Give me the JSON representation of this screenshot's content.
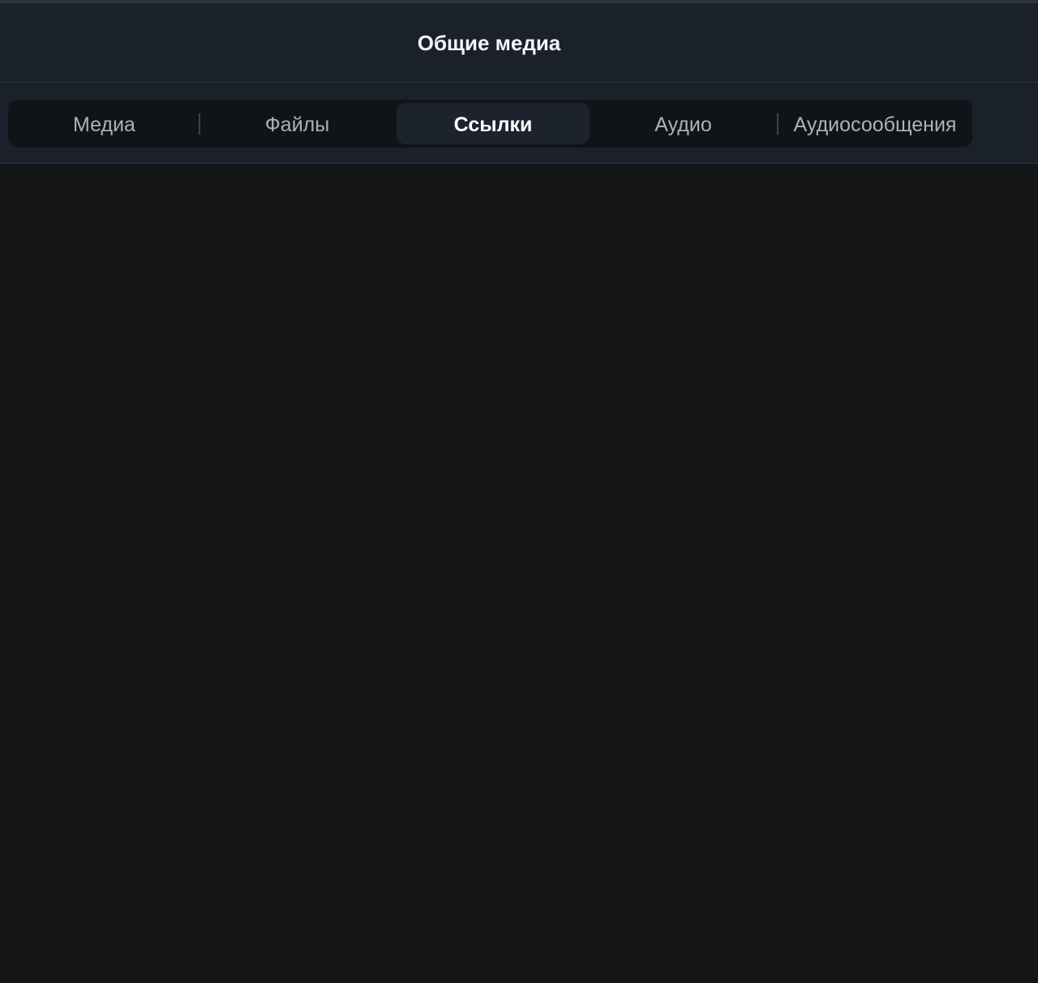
{
  "header": {
    "title": "Общие медиа"
  },
  "tabs": [
    {
      "label": "Медиа",
      "active": false
    },
    {
      "label": "Файлы",
      "active": false
    },
    {
      "label": "Ссылки",
      "active": true
    },
    {
      "label": "Аудио",
      "active": false
    },
    {
      "label": "Аудиосообщения",
      "active": false
    }
  ],
  "colors": {
    "background": "#141517",
    "header_background": "#1b212a",
    "segment_background": "#111417",
    "active_tab_background": "#1d232c",
    "active_text": "#ffffff",
    "inactive_text": "#aab2be"
  }
}
